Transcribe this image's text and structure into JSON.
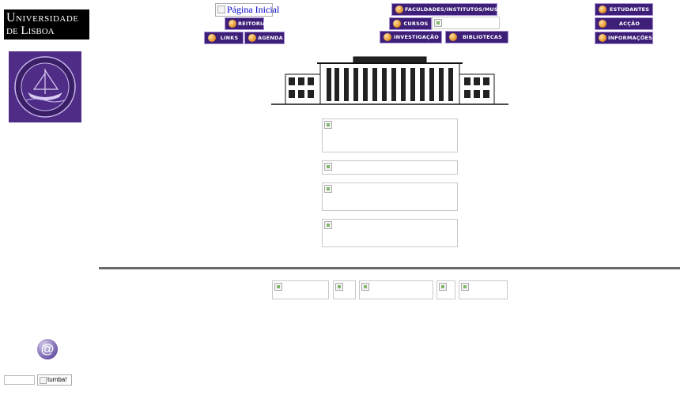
{
  "logo": {
    "line1": "Universidade",
    "line2": "de Lisboa"
  },
  "nav": {
    "pagina_inicial": "Página Inicial",
    "reitoria": "Reitoria",
    "links": "Links",
    "agenda": "Agenda",
    "faculdades": "Faculdades/Institutos/Museus",
    "cursos": "Cursos",
    "investigacao": "Investigação",
    "bibliotecas": "Bibliotecas",
    "estudantes": "Estudantes",
    "accao_social": "Acção Social",
    "informacoes": "Informações"
  },
  "search": {
    "button_alt": "tumba!"
  },
  "colors": {
    "nav_bg": "#3d1f78",
    "accent": "#e89a30",
    "divider": "#6a6a6a"
  }
}
